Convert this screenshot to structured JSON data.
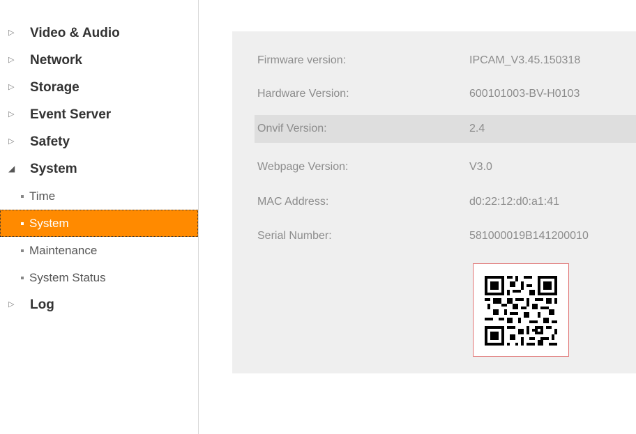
{
  "sidebar": {
    "categories": [
      {
        "label": "Video & Audio"
      },
      {
        "label": "Network"
      },
      {
        "label": "Storage"
      },
      {
        "label": "Event Server"
      },
      {
        "label": "Safety"
      },
      {
        "label": "System"
      },
      {
        "label": "Log"
      }
    ],
    "system_items": [
      {
        "label": "Time"
      },
      {
        "label": "System"
      },
      {
        "label": "Maintenance"
      },
      {
        "label": "System Status"
      }
    ]
  },
  "info": {
    "rows": [
      {
        "label": "Firmware version:",
        "value": "IPCAM_V3.45.150318"
      },
      {
        "label": "Hardware Version:",
        "value": "600101003-BV-H0103"
      },
      {
        "label": "Onvif Version:",
        "value": "2.4"
      },
      {
        "label": "Webpage Version:",
        "value": "V3.0"
      },
      {
        "label": "MAC Address:",
        "value": "d0:22:12:d0:a1:41"
      },
      {
        "label": "Serial Number:",
        "value": "581000019B141200010"
      }
    ]
  },
  "colors": {
    "accent": "#ff8a00",
    "panel_bg": "#efefef",
    "highlight_row": "#dedede"
  }
}
